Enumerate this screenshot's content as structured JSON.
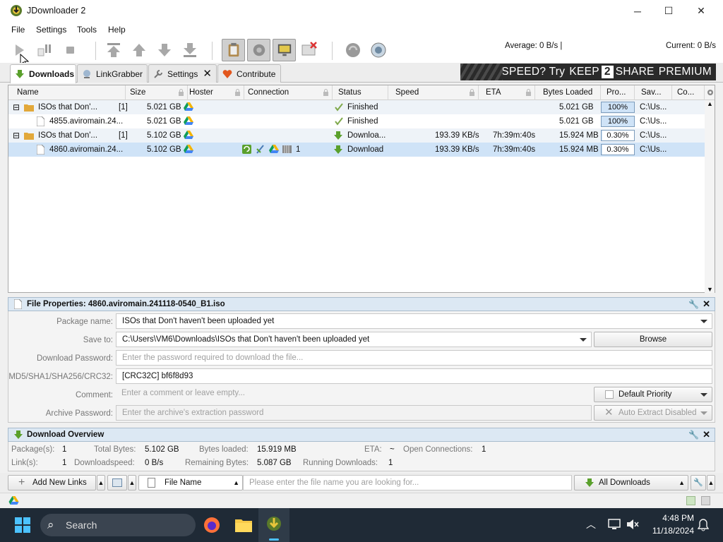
{
  "window": {
    "title": "JDownloader 2"
  },
  "menu": [
    "File",
    "Settings",
    "Tools",
    "Help"
  ],
  "toolbar": {
    "average_speed": "Average: 0 B/s |",
    "current_speed": "Current: 0 B/s"
  },
  "tabs": [
    {
      "label": "Downloads",
      "active": true
    },
    {
      "label": "LinkGrabber",
      "active": false
    },
    {
      "label": "Settings",
      "active": false
    },
    {
      "label": "Contribute",
      "active": false
    }
  ],
  "banner": {
    "prefix": "NEED SPEED? Try",
    "keep": "KEEP",
    "two": "2",
    "share": "SHARE",
    "premium": "PREMIUM"
  },
  "table": {
    "headers": [
      "Name",
      "Size",
      "Hoster",
      "Connection",
      "Status",
      "Speed",
      "ETA",
      "Bytes Loaded",
      "Pro...",
      "Sav...",
      "Co..."
    ],
    "rows": [
      {
        "type": "package",
        "expander": "⊟",
        "name": "ISOs that Don'...",
        "count": "[1]",
        "size": "5.021 GB",
        "status": "Finished",
        "speed": "",
        "eta": "",
        "bytes": "5.021 GB",
        "progress": "100%",
        "progress_value": 1.0,
        "save": "C:\\Us...",
        "selected": false
      },
      {
        "type": "file",
        "name": "4855.aviromain.24...",
        "count": "",
        "size": "5.021 GB",
        "status": "Finished",
        "speed": "",
        "eta": "",
        "bytes": "5.021 GB",
        "progress": "100%",
        "progress_value": 1.0,
        "save": "C:\\Us...",
        "selected": false
      },
      {
        "type": "package",
        "expander": "⊟",
        "name": "ISOs that Don'...",
        "count": "[1]",
        "size": "5.102 GB",
        "status": "Downloa...",
        "speed": "193.39 KB/s",
        "eta": "7h:39m:40s",
        "bytes": "15.924 MB",
        "progress": "0.30%",
        "progress_value": 0.003,
        "save": "C:\\Us...",
        "selected": false
      },
      {
        "type": "file",
        "name": "4860.aviromain.24...",
        "count": "",
        "size": "5.102 GB",
        "status": "Download",
        "speed": "193.39 KB/s",
        "eta": "7h:39m:40s",
        "bytes": "15.924 MB",
        "progress": "0.30%",
        "progress_value": 0.003,
        "save": "C:\\Us...",
        "selected": true,
        "connections": "1"
      }
    ]
  },
  "file_properties": {
    "title": "File Properties: 4860.aviromain.241118-0540_B1.iso",
    "labels": {
      "package_name": "Package name:",
      "save_to": "Save to:",
      "download_password": "Download Password:",
      "checksum": "MD5/SHA1/SHA256/CRC32:",
      "comment": "Comment:",
      "archive_password": "Archive Password:"
    },
    "package_name": "ISOs that Don't haven't been uploaded yet",
    "save_to": "C:\\Users\\VM6\\Downloads\\ISOs that Don't haven't been uploaded yet",
    "browse": "Browse",
    "download_password_placeholder": "Enter the password required to download the file...",
    "checksum": "[CRC32C] bf6f8d93",
    "comment_placeholder": "Enter a comment or leave empty...",
    "priority": "Default Priority",
    "archive_password_placeholder": "Enter the archive's extraction password",
    "auto_extract": "Auto Extract Disabled"
  },
  "overview": {
    "title": "Download Overview",
    "packages_label": "Package(s):",
    "packages": "1",
    "total_bytes_label": "Total Bytes:",
    "total_bytes": "5.102 GB",
    "bytes_loaded_label": "Bytes loaded:",
    "bytes_loaded": "15.919 MB",
    "eta_label": "ETA:",
    "eta": "~",
    "open_conn_label": "Open Connections:",
    "open_conn": "1",
    "links_label": "Link(s):",
    "links": "1",
    "dl_speed_label": "Downloadspeed:",
    "dl_speed": "0 B/s",
    "remaining_label": "Remaining Bytes:",
    "remaining": "5.087 GB",
    "running_label": "Running Downloads:",
    "running": "1"
  },
  "bottom": {
    "add_links": "Add New Links",
    "file_name": "File Name",
    "search_placeholder": "Please enter the file name you are looking for...",
    "all_downloads": "All Downloads"
  },
  "taskbar": {
    "search": "Search",
    "time": "4:48 PM",
    "date": "11/18/2024"
  },
  "colors": {
    "selected_row": "#cfe3f7",
    "package_row": "#eef3f8",
    "panel_header": "#dce8f3",
    "taskbar": "#1f2a36"
  }
}
